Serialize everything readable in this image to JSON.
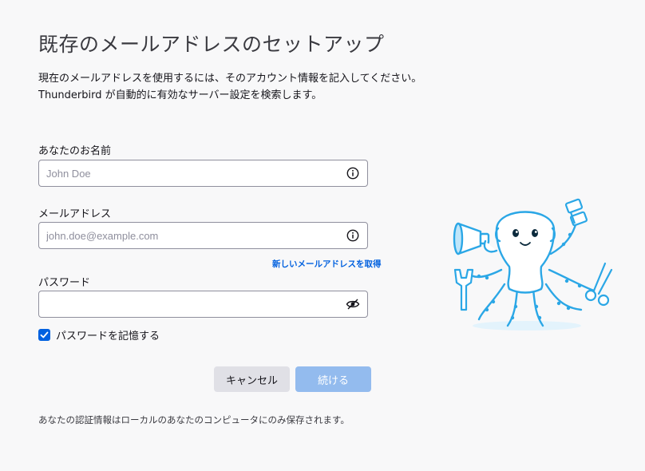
{
  "header": {
    "title": "既存のメールアドレスのセットアップ",
    "description_line1": "現在のメールアドレスを使用するには、そのアカウント情報を記入してください。",
    "description_line2": "Thunderbird が自動的に有効なサーバー設定を検索します。"
  },
  "form": {
    "name_label": "あなたのお名前",
    "name_placeholder": "John Doe",
    "name_value": "",
    "email_label": "メールアドレス",
    "email_placeholder": "john.doe@example.com",
    "email_value": "",
    "new_address_link": "新しいメールアドレスを取得",
    "password_label": "パスワード",
    "password_value": "",
    "remember_password_label": "パスワードを記憶する",
    "remember_password_checked": true
  },
  "buttons": {
    "cancel_label": "キャンセル",
    "continue_label": "続ける"
  },
  "footer": {
    "note": "あなたの認証情報はローカルのあなたのコンピュータにのみ保存されます。"
  },
  "icons": {
    "name_field_icon": "info-icon",
    "email_field_icon": "info-icon",
    "password_field_icon": "eye-slash-icon",
    "checkbox_icon": "checkmark-icon",
    "illustration": "octopus-illustration"
  },
  "colors": {
    "accent": "#0061e0",
    "link": "#0060df",
    "continue_button_disabled": "#93bbee",
    "cancel_button": "#e0e0e6",
    "background": "#f8f8f9"
  }
}
